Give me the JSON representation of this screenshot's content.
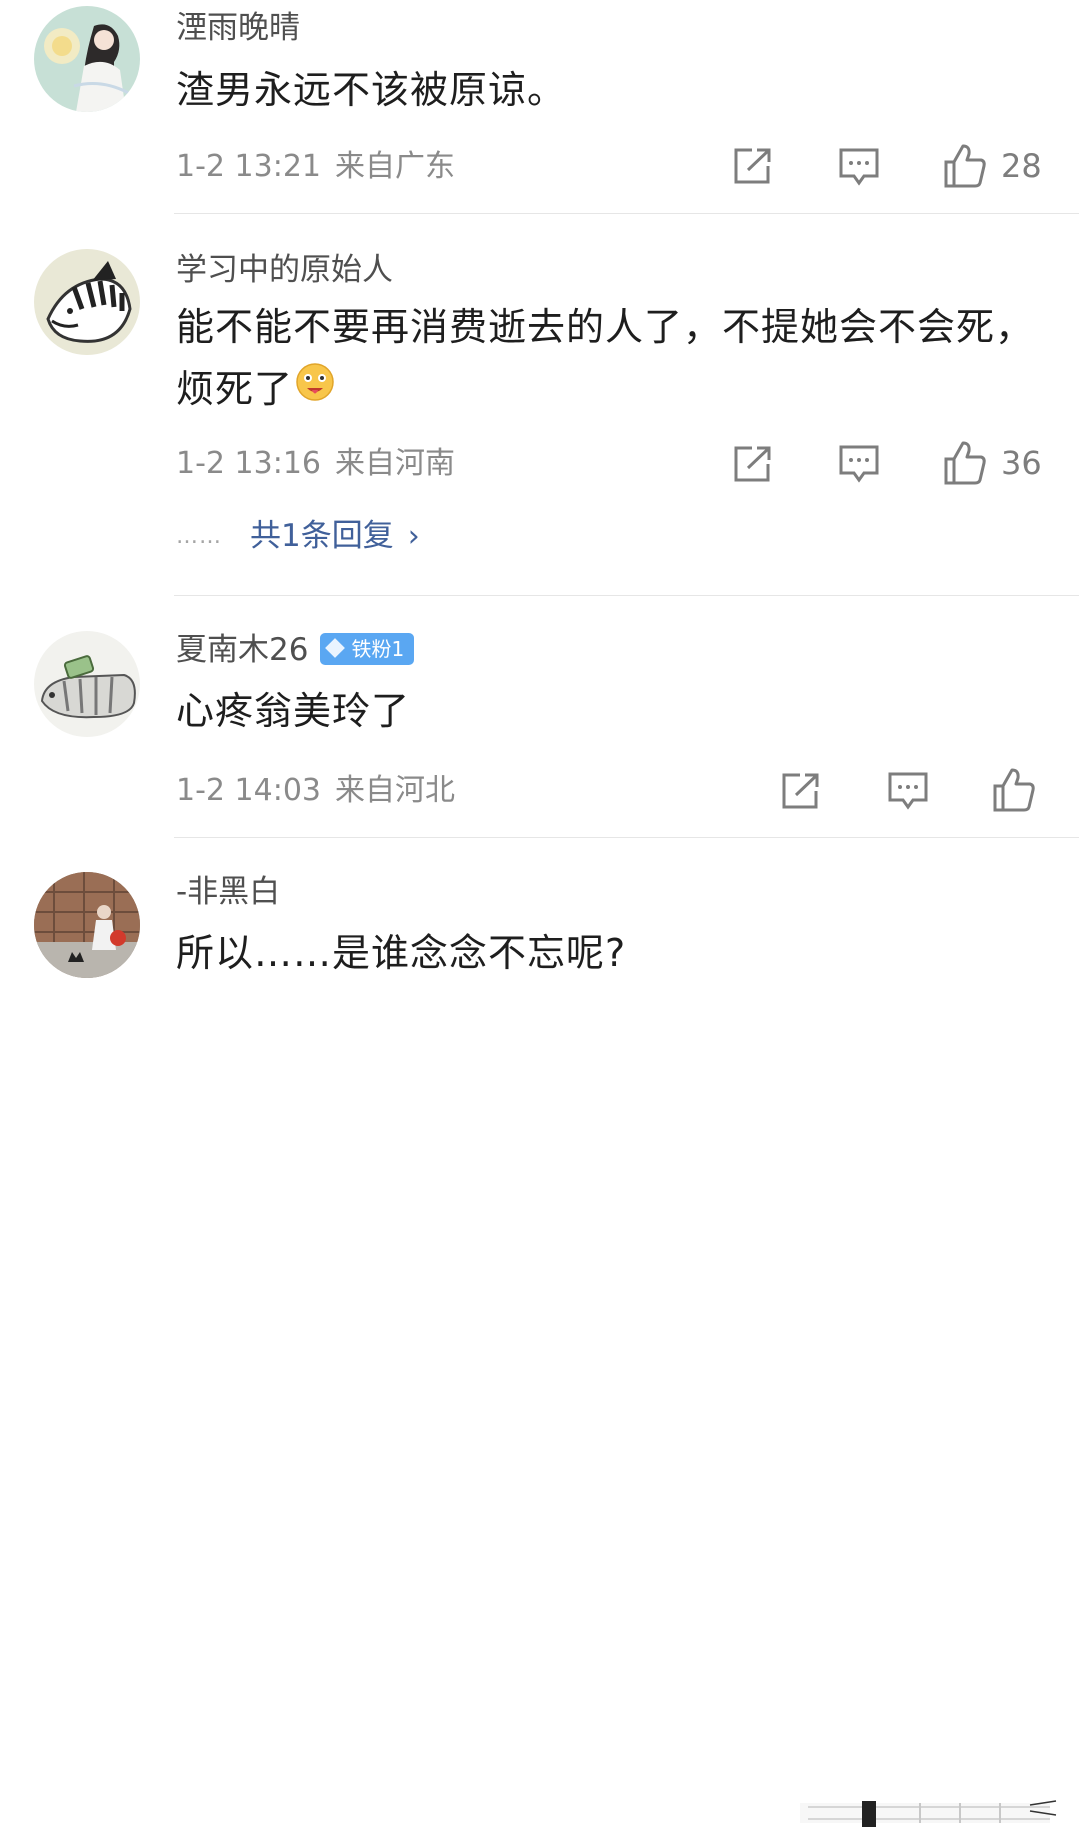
{
  "comments": [
    {
      "username": "湮雨晚晴",
      "text": "渣男永远不该被原谅。",
      "time": "1-2 13:21",
      "location": "来自广东",
      "likes": "28"
    },
    {
      "username": "学习中的原始人",
      "text": "能不能不要再消费逝去的人了，不提她会不会死，烦死了",
      "time": "1-2 13:16",
      "location": "来自河南",
      "likes": "36",
      "reply_dots": "……",
      "reply_link": "共1条回复",
      "reply_chevron": "›"
    },
    {
      "username": "夏南木26",
      "badge": "铁粉1",
      "text": "心疼翁美玲了",
      "time": "1-2 14:03",
      "location": "来自河北",
      "likes": ""
    },
    {
      "username": "-非黑白",
      "text": "所以……是谁念念不忘呢?"
    }
  ],
  "icons": {
    "share": "share-icon",
    "comment": "comment-icon",
    "like": "thumbs-up-icon",
    "emoji": "emoji-icon"
  },
  "colors": {
    "username": "#4f4f4f",
    "meta": "#8a8a8a",
    "reply_link": "#40609a",
    "badge": "#5aa7f2",
    "divider": "#e6e6e6"
  }
}
